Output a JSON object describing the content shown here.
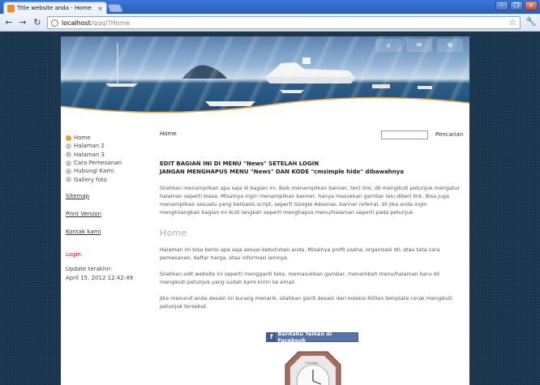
{
  "browser": {
    "tab_title": "Title website anda - Home",
    "favicon": "RSS",
    "url_host": "localhost",
    "url_path": "/qqq/?Home"
  },
  "icons": {
    "back": "back-arrow-icon",
    "forward": "forward-arrow-icon",
    "reload": "reload-icon",
    "star": "bookmark-star-icon",
    "wrench": "wrench-icon",
    "header": [
      "home-icon",
      "mail-icon",
      "sitemap-icon"
    ]
  },
  "colors": {
    "accent": "#f0a030",
    "login": "#cc1a1a",
    "facebook": "#5873a8"
  },
  "sidebar": {
    "menu": [
      {
        "label": "Home",
        "active": true
      },
      {
        "label": "Halaman 2",
        "active": false
      },
      {
        "label": "Halaman 3",
        "active": false
      },
      {
        "label": "Cara Pemesanan",
        "active": false
      },
      {
        "label": "Hubungi Kami",
        "active": false
      },
      {
        "label": "Gallery foto",
        "active": false
      }
    ],
    "links": [
      "Sitemap",
      "Print Version",
      "Kontak kami"
    ],
    "login": "Login",
    "updated_label": "Update terakhir:",
    "updated_value": "April 15. 2012 12:42:49"
  },
  "main": {
    "breadcrumb": "Home",
    "search_label": "Pencarian",
    "notice_line1": "EDIT BAGIAN INI DI MENU \"News\" SETELAH LOGIN",
    "notice_line2": "JANGAN MENGHAPUS MENU \"News\" DAN KODE \"cmsimple hide\" dibawahnya",
    "p1": "Silahkan menampilkan apa saja di bagian ini. Baik menampilkan banner, text link, dll mengikuti petunjuk mengatur halaman seperti biasa. Misalnya ingin menampilkan banner, hanya masukkan gambar lalu diberi link. Bisa juga menampilkan sesuatu yang berbasis script, seperti Google Adsense, banner referral, dll Jika anda ingin menghilangkan bagian ini ikuti langkah seperti menghapus menu/halaman seperti pada petunjuk.",
    "heading": "Home",
    "p2": "Halaman ini bisa berisi apa saja sesuai kebutuhan anda. Misalnya profil usaha, organisasi dll, atau tata cara pemesanan, daftar harga, atau informasi lainnya.",
    "p3": "Silahkan edit website ini seperti mengganti teks, memasukkan gambar, menambah menu/halaman baru dll mengikuti petunjuk yang sudah kami kirim ke email.",
    "p4": "Jika menurut anda desain ini kurang menarik, silahkan ganti desain dari koleksi 600an template corak mengikuti petunjuk tersebut.",
    "facebook_button": "Beritahu Teman di Facebook",
    "clock_brand": "Christin..."
  }
}
